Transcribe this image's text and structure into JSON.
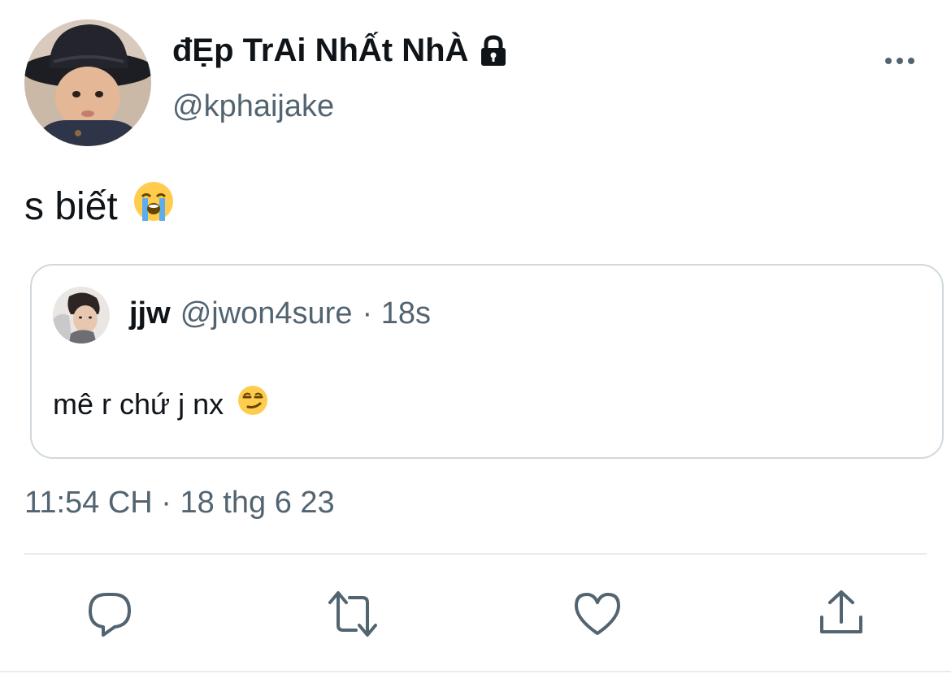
{
  "author": {
    "display_name": "đẸp TrAi NhẤt NhÀ",
    "handle": "@kphaijake",
    "avatar_icon": "profile-photo-child-hat",
    "lock_icon": "lock-icon"
  },
  "tweet": {
    "text": "s biết",
    "emoji": "😭"
  },
  "quote": {
    "name": "jjw",
    "handle": "@jwon4sure",
    "time": "· 18s",
    "text": "mê r chứ j nx",
    "emoji": "😏"
  },
  "timestamp": "11:54 CH · 18 thg 6 23",
  "actions": [
    "reply-icon",
    "retweet-icon",
    "like-icon",
    "share-icon"
  ],
  "colors": {
    "text": "#0f1419",
    "secondary": "#536471",
    "border": "#cfd9de",
    "icon": "#536471"
  }
}
